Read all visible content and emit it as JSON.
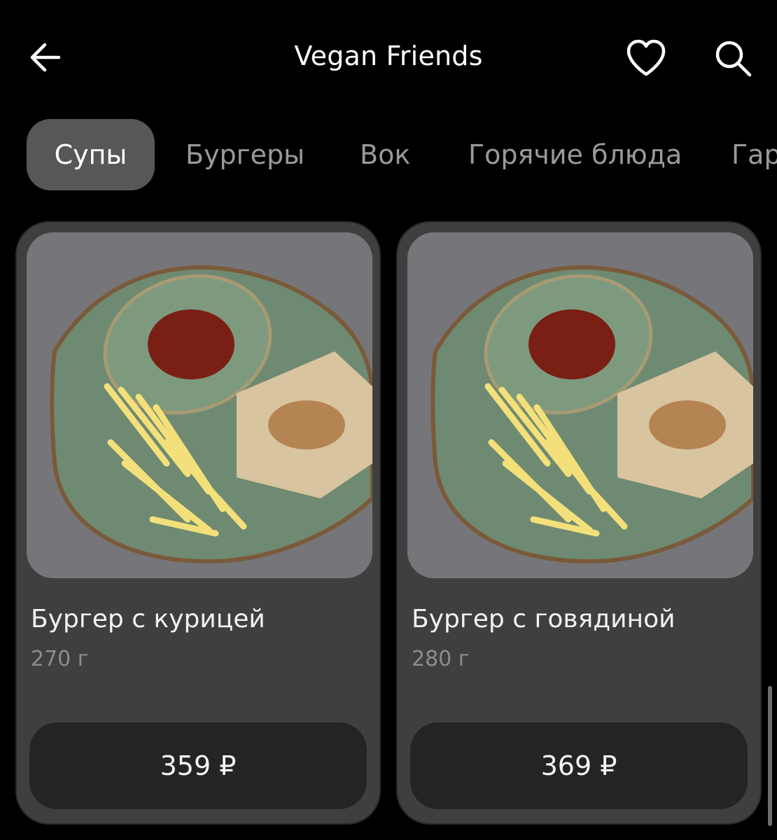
{
  "header": {
    "title": "Vegan Friends",
    "icons": {
      "back": "arrow-left-icon",
      "favorite": "heart-icon",
      "search": "search-icon"
    }
  },
  "tabs": [
    {
      "label": "Супы",
      "active": true
    },
    {
      "label": "Бургеры",
      "active": false
    },
    {
      "label": "Вок",
      "active": false
    },
    {
      "label": "Горячие блюда",
      "active": false
    },
    {
      "label": "Гар",
      "active": false
    }
  ],
  "products": [
    {
      "name": "Бургер с курицей",
      "weight": "270 г",
      "price": "359 ₽"
    },
    {
      "name": "Бургер с говядиной",
      "weight": "280 г",
      "price": "369 ₽"
    }
  ],
  "colors": {
    "background": "#000000",
    "card": "#3f3f3f",
    "active_tab": "#57575a",
    "price_button": "#242424",
    "muted_text": "#8d8d8d"
  }
}
